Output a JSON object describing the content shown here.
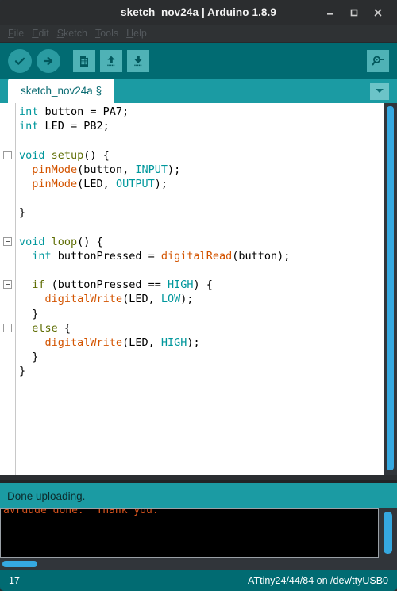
{
  "window": {
    "title": "sketch_nov24a | Arduino 1.8.9",
    "controls": {
      "minimize": "minimize-icon",
      "maximize": "maximize-icon",
      "close": "close-icon"
    }
  },
  "menu": {
    "items": [
      {
        "mnemonic": "F",
        "rest": "ile"
      },
      {
        "mnemonic": "E",
        "rest": "dit"
      },
      {
        "mnemonic": "S",
        "rest": "ketch"
      },
      {
        "mnemonic": "T",
        "rest": "ools"
      },
      {
        "mnemonic": "H",
        "rest": "elp"
      }
    ]
  },
  "toolbar": {
    "verify": "Verify",
    "upload": "Upload",
    "new": "New",
    "open": "Open",
    "save": "Save",
    "serial_monitor": "Serial Monitor"
  },
  "tabs": {
    "active": "sketch_nov24a §",
    "dropdown": "Tab menu"
  },
  "editor": {
    "lines": [
      {
        "indent": 0,
        "fold": false,
        "tokens": [
          {
            "t": "int",
            "c": "k-type"
          },
          {
            "t": " button = PA7;",
            "c": "k-plain"
          }
        ]
      },
      {
        "indent": 0,
        "fold": false,
        "tokens": [
          {
            "t": "int",
            "c": "k-type"
          },
          {
            "t": " LED = PB2;",
            "c": "k-plain"
          }
        ]
      },
      {
        "indent": 0,
        "fold": false,
        "tokens": []
      },
      {
        "indent": 0,
        "fold": true,
        "tokens": [
          {
            "t": "void",
            "c": "k-type"
          },
          {
            "t": " ",
            "c": "k-plain"
          },
          {
            "t": "setup",
            "c": "k-fn"
          },
          {
            "t": "() {",
            "c": "k-plain"
          }
        ]
      },
      {
        "indent": 0,
        "fold": false,
        "tokens": [
          {
            "t": "  ",
            "c": "k-plain"
          },
          {
            "t": "pinMode",
            "c": "k-call"
          },
          {
            "t": "(button, ",
            "c": "k-plain"
          },
          {
            "t": "INPUT",
            "c": "k-const"
          },
          {
            "t": ");",
            "c": "k-plain"
          }
        ]
      },
      {
        "indent": 0,
        "fold": false,
        "tokens": [
          {
            "t": "  ",
            "c": "k-plain"
          },
          {
            "t": "pinMode",
            "c": "k-call"
          },
          {
            "t": "(LED, ",
            "c": "k-plain"
          },
          {
            "t": "OUTPUT",
            "c": "k-const"
          },
          {
            "t": ");",
            "c": "k-plain"
          }
        ]
      },
      {
        "indent": 0,
        "fold": false,
        "tokens": []
      },
      {
        "indent": 0,
        "fold": false,
        "tokens": [
          {
            "t": "}",
            "c": "k-plain"
          }
        ]
      },
      {
        "indent": 0,
        "fold": false,
        "tokens": []
      },
      {
        "indent": 0,
        "fold": true,
        "tokens": [
          {
            "t": "void",
            "c": "k-type"
          },
          {
            "t": " ",
            "c": "k-plain"
          },
          {
            "t": "loop",
            "c": "k-fn"
          },
          {
            "t": "() {",
            "c": "k-plain"
          }
        ]
      },
      {
        "indent": 0,
        "fold": false,
        "tokens": [
          {
            "t": "  ",
            "c": "k-plain"
          },
          {
            "t": "int",
            "c": "k-type"
          },
          {
            "t": " buttonPressed = ",
            "c": "k-plain"
          },
          {
            "t": "digitalRead",
            "c": "k-call"
          },
          {
            "t": "(button);",
            "c": "k-plain"
          }
        ]
      },
      {
        "indent": 0,
        "fold": false,
        "tokens": []
      },
      {
        "indent": 0,
        "fold": true,
        "tokens": [
          {
            "t": "  ",
            "c": "k-plain"
          },
          {
            "t": "if",
            "c": "k-fn"
          },
          {
            "t": " (buttonPressed == ",
            "c": "k-plain"
          },
          {
            "t": "HIGH",
            "c": "k-const"
          },
          {
            "t": ") {",
            "c": "k-plain"
          }
        ]
      },
      {
        "indent": 0,
        "fold": false,
        "tokens": [
          {
            "t": "    ",
            "c": "k-plain"
          },
          {
            "t": "digitalWrite",
            "c": "k-call"
          },
          {
            "t": "(LED, ",
            "c": "k-plain"
          },
          {
            "t": "LOW",
            "c": "k-const"
          },
          {
            "t": ");",
            "c": "k-plain"
          }
        ]
      },
      {
        "indent": 0,
        "fold": false,
        "tokens": [
          {
            "t": "  }",
            "c": "k-plain"
          }
        ]
      },
      {
        "indent": 0,
        "fold": true,
        "tokens": [
          {
            "t": "  ",
            "c": "k-plain"
          },
          {
            "t": "else",
            "c": "k-fn"
          },
          {
            "t": " {",
            "c": "k-plain"
          }
        ]
      },
      {
        "indent": 0,
        "fold": false,
        "tokens": [
          {
            "t": "    ",
            "c": "k-plain"
          },
          {
            "t": "digitalWrite",
            "c": "k-call"
          },
          {
            "t": "(LED, ",
            "c": "k-plain"
          },
          {
            "t": "HIGH",
            "c": "k-const"
          },
          {
            "t": ");",
            "c": "k-plain"
          }
        ]
      },
      {
        "indent": 0,
        "fold": false,
        "tokens": [
          {
            "t": "  }",
            "c": "k-plain"
          }
        ]
      },
      {
        "indent": 0,
        "fold": false,
        "tokens": [
          {
            "t": "}",
            "c": "k-plain"
          }
        ]
      }
    ]
  },
  "message": {
    "text": "Done uploading."
  },
  "console": {
    "line": "avrdude done.  Thank you."
  },
  "status": {
    "line_number": "17",
    "board": "ATtiny24/44/84 on /dev/ttyUSB0"
  },
  "colors": {
    "accent_teal": "#1b9ba3",
    "toolbar_teal": "#016b72",
    "scrollbar_blue": "#35a8e0",
    "console_orange": "#d9541e",
    "type_keyword": "#00979c",
    "function_name": "#5e6d03",
    "function_call": "#d35400"
  }
}
